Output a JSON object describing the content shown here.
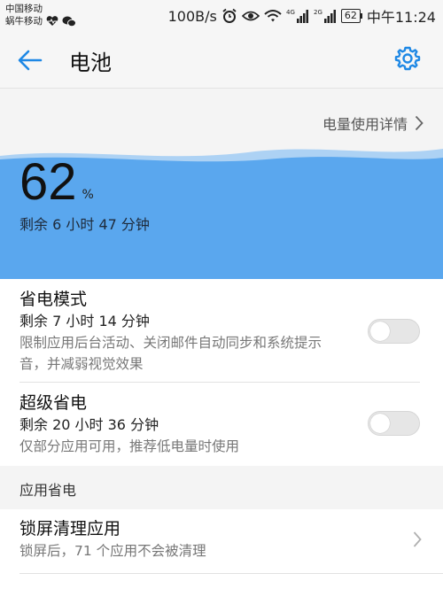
{
  "status_bar": {
    "carrier1": "中国移动",
    "carrier2": "蜗牛移动",
    "net_speed": "100B/s",
    "net1": "4G",
    "net2": "2G",
    "battery": "62",
    "time": "中午11:24"
  },
  "app_bar": {
    "title": "电池",
    "back_icon": "arrow-left-icon",
    "settings_icon": "gear-icon",
    "accent": "#1e88e5"
  },
  "battery": {
    "detail_link": "电量使用详情",
    "percent": "62",
    "percent_unit": "%",
    "percent_level": 62,
    "remaining": "剩余 6 小时 47 分钟",
    "wave_color": "#5aa7ee"
  },
  "power_saving": {
    "title": "省电模式",
    "remaining": "剩余 7 小时 14 分钟",
    "description": "限制应用后台活动、关闭邮件自动同步和系统提示音，并减弱视觉效果",
    "enabled": false
  },
  "ultra_saving": {
    "title": "超级省电",
    "remaining": "剩余 20 小时 36 分钟",
    "description": "仅部分应用可用，推荐低电量时使用",
    "enabled": false
  },
  "app_saving": {
    "header": "应用省电",
    "lockscreen_title": "锁屏清理应用",
    "lockscreen_desc": "锁屏后，71 个应用不会被清理"
  }
}
